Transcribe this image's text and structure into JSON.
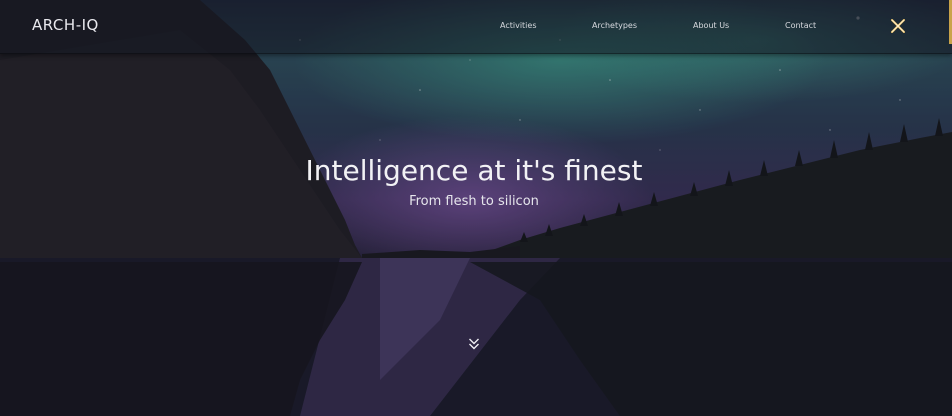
{
  "navbar": {
    "brand": "ARCH-IQ",
    "links": [
      {
        "label": "Activities"
      },
      {
        "label": "Archetypes"
      },
      {
        "label": "About Us"
      },
      {
        "label": "Contact"
      }
    ],
    "close_icon": "close-x-icon"
  },
  "hero": {
    "title": "Intelligence at it's finest",
    "subtitle": "From flesh to silicon",
    "scroll_icon": "double-chevron-down-icon"
  },
  "colors": {
    "accent": "#c9a34a",
    "text": "#f2f2f5"
  }
}
